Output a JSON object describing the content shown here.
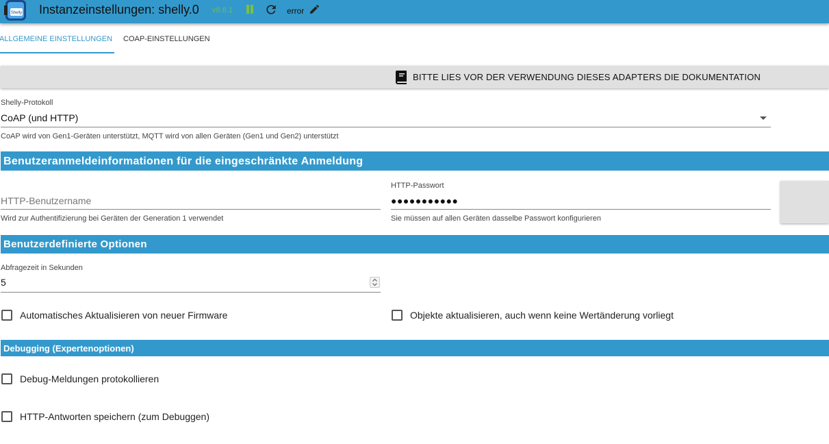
{
  "header": {
    "title": "Instanzeinstellungen: shelly.0",
    "version": "v8.6.1",
    "status": "error",
    "icons": [
      "shelly-logo-icon",
      "pause-icon",
      "reload-icon",
      "edit-icon"
    ],
    "colors": {
      "bar": "#3399cc",
      "pause": "#7ac142"
    }
  },
  "tabs": [
    {
      "label": "Allgemeine Einstellungen",
      "active": true
    },
    {
      "label": "CoAP-Einstellungen",
      "active": false
    }
  ],
  "documentation_button": {
    "label": "Bitte lies vor der Verwendung dieses Adapters die Dokumentation",
    "icon": "book-icon"
  },
  "protocol": {
    "label": "Shelly-Protokoll",
    "value": "CoAP (und HTTP)",
    "helper": "CoAP wird von Gen1-Geräten unterstützt, MQTT wird von allen Geräten (Gen1 und Gen2) unterstützt"
  },
  "sections": {
    "login": "Benutzeranmeldeinformationen für die eingeschränkte Anmeldung",
    "custom": "Benutzerdefinierte Optionen",
    "debug": "Debugging (Expertenoptionen)"
  },
  "username": {
    "placeholder": "HTTP-Benutzername",
    "helper": "Wird zur Authentifizierung bei Geräten der Generation 1 verwendet"
  },
  "password": {
    "label": "HTTP-Passwort",
    "value": "●●●●●●●●●●●",
    "helper": "Sie müssen auf allen Geräten dasselbe Passwort konfigurieren"
  },
  "polling": {
    "label": "Abfragezeit in Sekunden",
    "value": "5"
  },
  "checkboxes": {
    "auto_update": "Automatisches Aktualisieren von neuer Firmware",
    "update_objects": "Objekte aktualisieren, auch wenn keine Wertänderung vorliegt",
    "debug_messages": "Debug-Meldungen protokollieren",
    "save_http": "HTTP-Antworten speichern (zum Debuggen)"
  }
}
